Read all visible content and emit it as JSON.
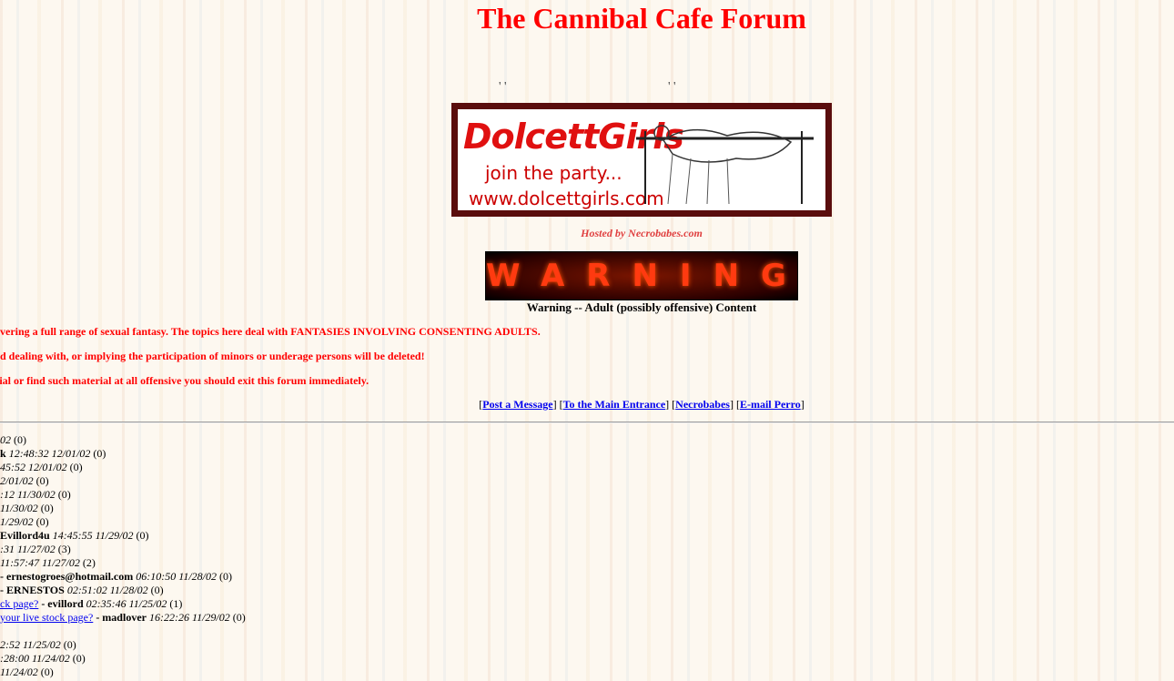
{
  "page": {
    "title": "The Cannibal Cafe Forum",
    "quote_marks_left": "' '",
    "quote_marks_right": "' '"
  },
  "banner": {
    "logo_text": "DolcettGirls",
    "tagline": "join the party...",
    "url": "www.dolcettgirls.com"
  },
  "hosted_by": "Hosted by Necrobabes.com",
  "warning": {
    "image_text": "WARNING!",
    "caption": "Warning -- Adult (possibly offensive) Content"
  },
  "notices": [
    "overing a full range of sexual fantasy. The topics here deal with FANTASIES INVOLVING CONSENTING ADULTS.",
    "ad dealing with, or implying the participation of minors or underage persons will be deleted!",
    "rial or find such material at all offensive you should exit this forum immediately."
  ],
  "nav": {
    "post": "Post a Message",
    "main": "To the Main Entrance",
    "necrobabes": "Necrobabes",
    "email": "E-mail Perro"
  },
  "messages": [
    {
      "link": "",
      "author": "",
      "time": "02",
      "count": "(0)"
    },
    {
      "link": "",
      "author": "k",
      "time": "12:48:32 12/01/02",
      "count": "(0)"
    },
    {
      "link": "",
      "author": "",
      "time": "45:52 12/01/02",
      "count": "(0)"
    },
    {
      "link": "",
      "author": "",
      "time": "2/01/02",
      "count": "(0)"
    },
    {
      "link": "",
      "author": "",
      "time": ":12 11/30/02",
      "count": "(0)"
    },
    {
      "link": "",
      "author": "",
      "time": "11/30/02",
      "count": "(0)"
    },
    {
      "link": "",
      "author": "",
      "time": "1/29/02",
      "count": "(0)"
    },
    {
      "link": "",
      "author": "Evillord4u",
      "time": "14:45:55 11/29/02",
      "count": "(0)"
    },
    {
      "link": "",
      "author": "",
      "time": ":31 11/27/02",
      "count": "(3)"
    },
    {
      "link": "",
      "author": "",
      "time": "11:57:47 11/27/02",
      "count": "(2)"
    },
    {
      "link": "",
      "author": "- ernestogroes@hotmail.com",
      "time": "06:10:50 11/28/02",
      "count": "(0)"
    },
    {
      "link": "",
      "author": "- ERNESTOS",
      "time": "02:51:02 11/28/02",
      "count": "(0)"
    },
    {
      "link": "ck page?",
      "author": "- evillord",
      "time": "02:35:46 11/25/02",
      "count": "(1)"
    },
    {
      "link": "your live stock page?",
      "author": "- madlover",
      "time": "16:22:26 11/29/02",
      "count": "(0)"
    },
    {
      "link": "",
      "author": "",
      "time": "",
      "count": ""
    },
    {
      "link": "",
      "author": "",
      "time": "2:52 11/25/02",
      "count": "(0)"
    },
    {
      "link": "",
      "author": "",
      "time": ":28:00 11/24/02",
      "count": "(0)"
    },
    {
      "link": "",
      "author": "",
      "time": "11/24/02",
      "count": "(0)"
    }
  ],
  "colors": {
    "title_red": "#ff0000",
    "link_blue": "#0000ee",
    "banner_frame": "#5a0d0d"
  }
}
